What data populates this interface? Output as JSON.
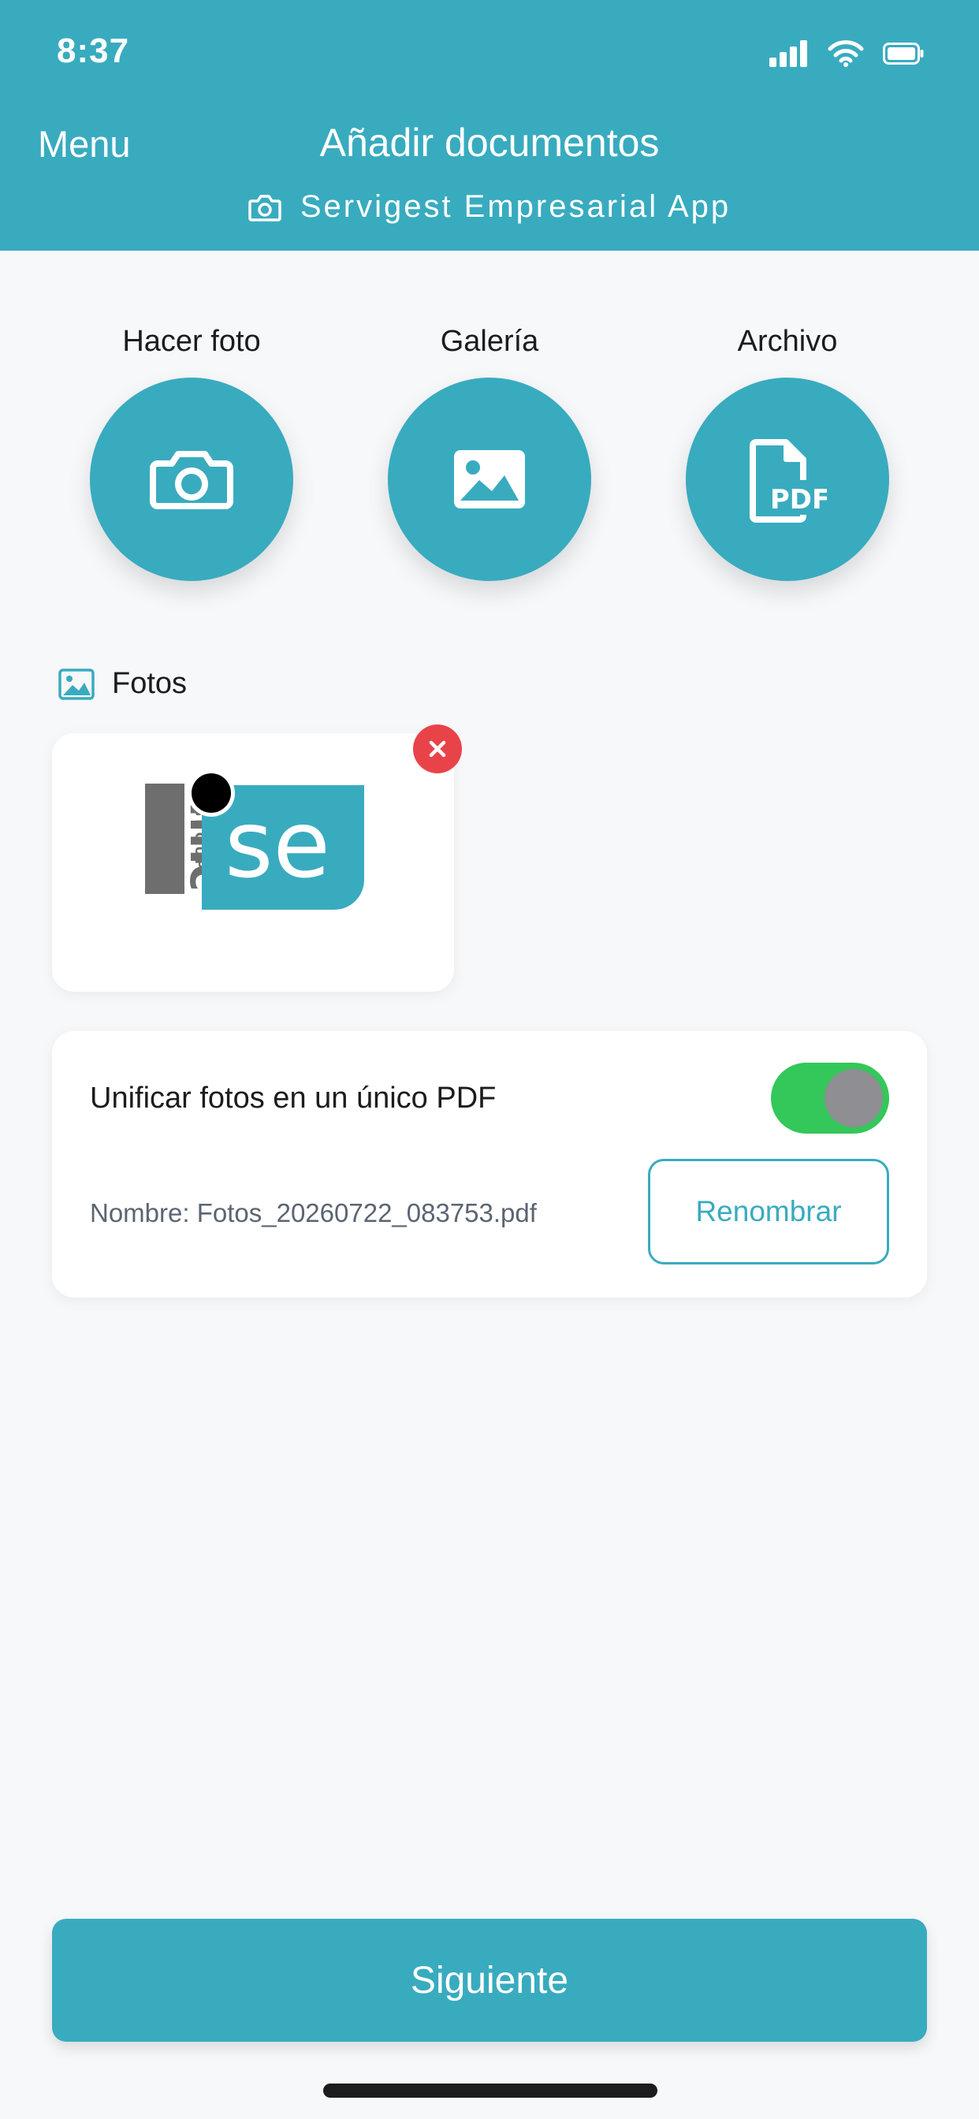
{
  "status_bar": {
    "time": "8:37"
  },
  "nav": {
    "menu_label": "Menu",
    "title": "Añadir documentos",
    "subtitle": "Servigest Empresarial App"
  },
  "actions": [
    {
      "label": "Hacer foto",
      "icon": "camera-icon"
    },
    {
      "label": "Galería",
      "icon": "image-icon"
    },
    {
      "label": "Archivo",
      "icon": "pdf-file-icon",
      "icon_text": "PDF"
    }
  ],
  "photos_section": {
    "title": "Fotos",
    "items": [
      {
        "logo_text": "se",
        "logo_brand": "amc",
        "logo_sub": "GROUP"
      }
    ]
  },
  "unify": {
    "label": "Unificar fotos en un único PDF",
    "enabled": true,
    "filename": "Nombre: Fotos_20260722_083753.pdf",
    "rename_label": "Renombrar"
  },
  "next_label": "Siguiente",
  "colors": {
    "primary": "#39abbf",
    "toggle_on": "#34c759",
    "remove": "#e9434a",
    "background": "#f7f8fa"
  }
}
